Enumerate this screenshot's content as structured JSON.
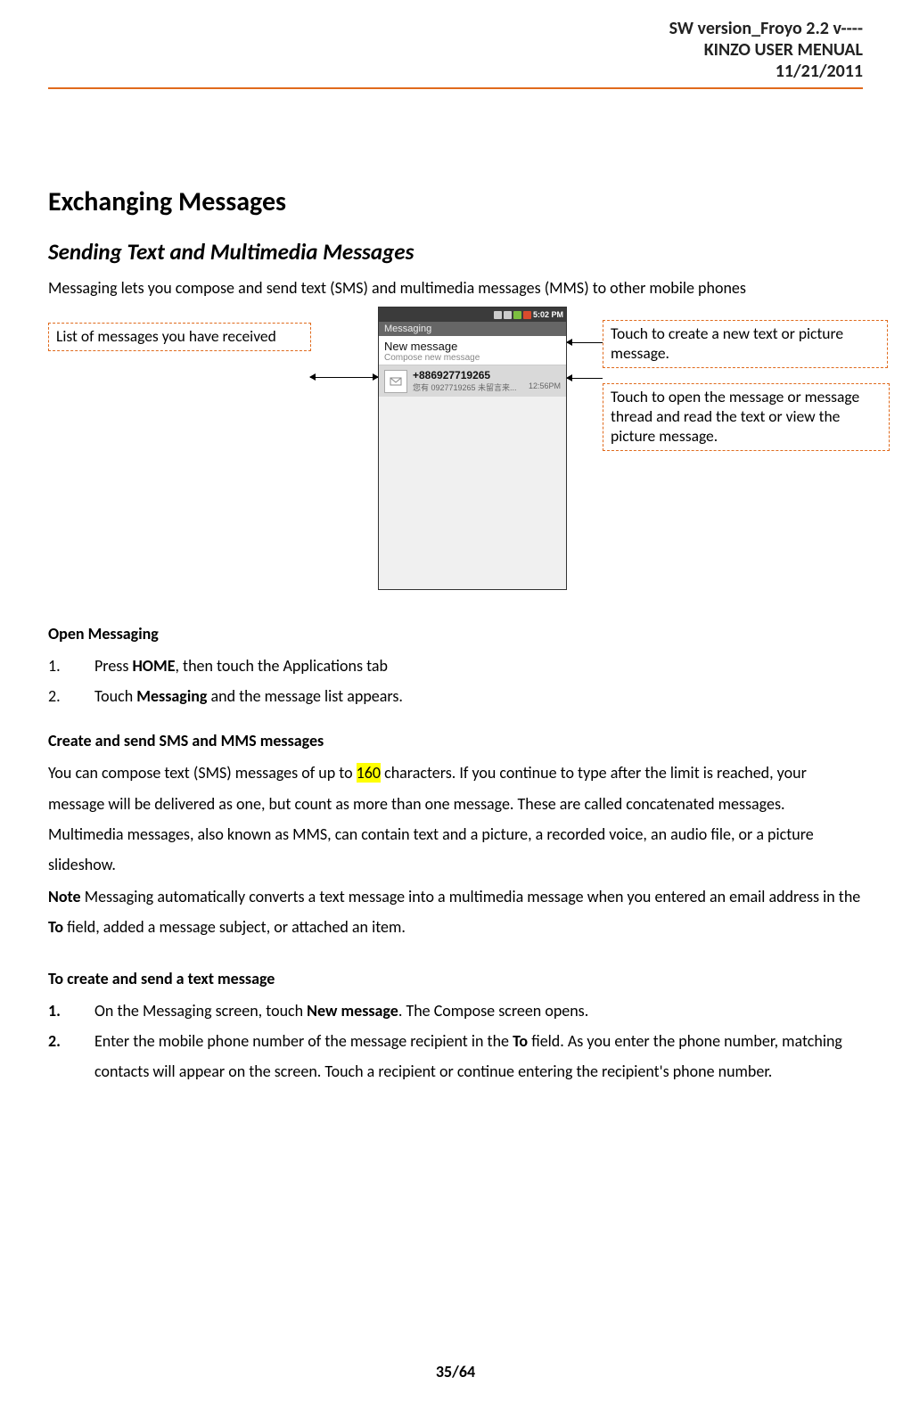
{
  "header": {
    "line1": "SW version_Froyo 2.2 v----",
    "line2": "KINZO USER MENUAL",
    "line3": "11/21/2011"
  },
  "main": {
    "h1": "Exchanging Messages",
    "h2": "Sending Text and Multimedia Messages",
    "intro": "Messaging lets you compose and send text (SMS) and multimedia messages (MMS) to other mobile phones"
  },
  "diagram": {
    "callout_left": "List of messages you have received",
    "callout_r1": "Touch to create a new text or picture message.",
    "callout_r2": "Touch to open the message or message thread and read the text or view the picture message.",
    "phone": {
      "status_time": "5:02 PM",
      "app_title": "Messaging",
      "new_msg_title": "New message",
      "new_msg_sub": "Compose new message",
      "thread_number": "+886927719265",
      "thread_sub": "您有 0927719265 未留言来...",
      "thread_time": "12:56PM"
    }
  },
  "section_open": {
    "title": "Open Messaging",
    "step1_pre": "Press ",
    "step1_bold": "HOME",
    "step1_post": ", then touch the Applications tab",
    "step2_pre": "Touch ",
    "step2_bold": "Messaging",
    "step2_post": " and the message list appears."
  },
  "section_create": {
    "title": "Create and send SMS and MMS messages",
    "p1a": "You can compose text (SMS) messages of up to ",
    "p1_hl": "160",
    "p1b": " characters. If you continue to type after the limit is reached, your message will be delivered as one, but count as more than one message. These are called concatenated messages. Multimedia messages, also known as MMS, can contain text and a picture, a recorded voice, an audio file, or a picture slideshow.",
    "note_label": "Note",
    "note_a": " Messaging automatically converts a text message into a multimedia message when you entered an email address in the ",
    "note_to": "To",
    "note_b": " field, added a message subject, or attached an item."
  },
  "section_send": {
    "title": "To create and send a text message",
    "s1a": "On the Messaging screen, touch ",
    "s1_bold": "New message",
    "s1b": ". The Compose screen opens.",
    "s2a": "Enter the mobile phone number of the message recipient in the ",
    "s2_bold": "To",
    "s2b": " field. As you enter the phone number, matching contacts will appear on the screen. Touch a recipient or continue entering the recipient's phone number."
  },
  "nums": {
    "n1": "1.",
    "n2": "2.",
    "b1": "1.",
    "b2": "2."
  },
  "footer": "35/64"
}
